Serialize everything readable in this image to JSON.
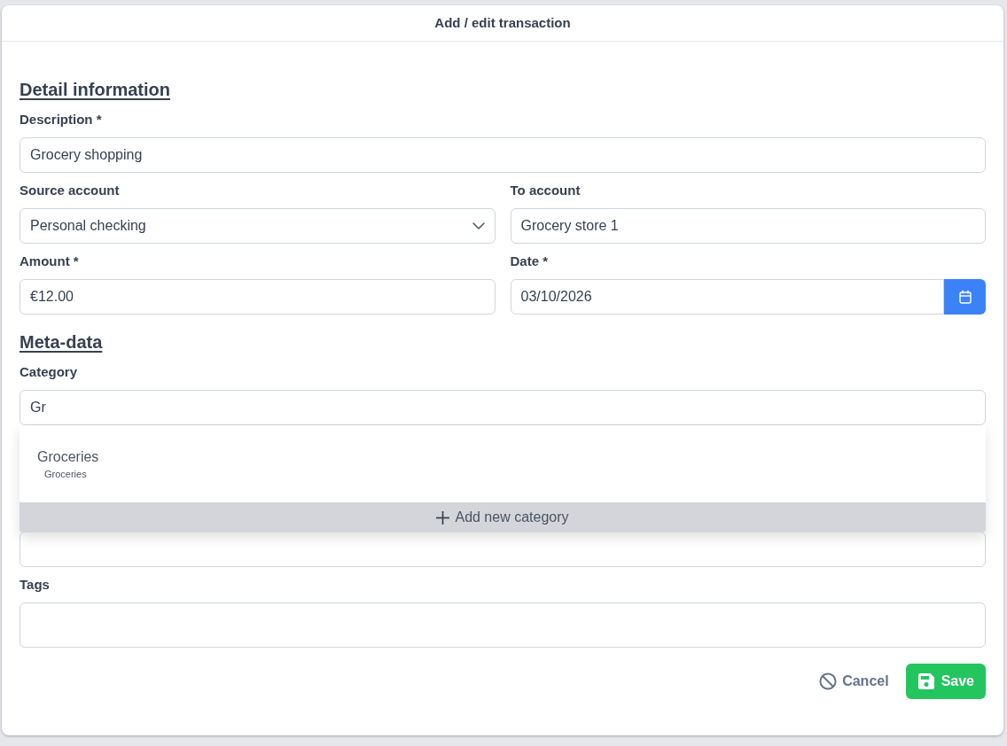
{
  "dialog": {
    "title": "Add / edit transaction"
  },
  "sections": [
    {
      "heading": "Detail information",
      "rows": [
        [
          {
            "kind": "text",
            "label": "Description *",
            "value": "Grocery shopping"
          }
        ],
        [
          {
            "kind": "select",
            "label": "Source account",
            "value": "Personal checking"
          },
          {
            "kind": "text",
            "label": "To account",
            "value": "Grocery store 1"
          }
        ],
        [
          {
            "kind": "text",
            "label": "Amount *",
            "value": "€12.00"
          },
          {
            "kind": "date",
            "label": "Date *",
            "value": "03/10/2026"
          }
        ]
      ]
    },
    {
      "heading": "Meta-data",
      "rows": [
        [
          {
            "kind": "autocomplete",
            "label": "Category",
            "value": "Gr",
            "suggestions": [
              {
                "name": "Groceries",
                "path": "Groceries"
              }
            ],
            "add_option": "Add new category"
          }
        ],
        [
          {
            "kind": "text"
          }
        ],
        [
          {
            "kind": "textarea",
            "label": "Tags"
          }
        ]
      ]
    }
  ],
  "actions": [
    {
      "kind": "cancel",
      "label": "Cancel"
    },
    {
      "kind": "save",
      "label": "Save"
    }
  ]
}
